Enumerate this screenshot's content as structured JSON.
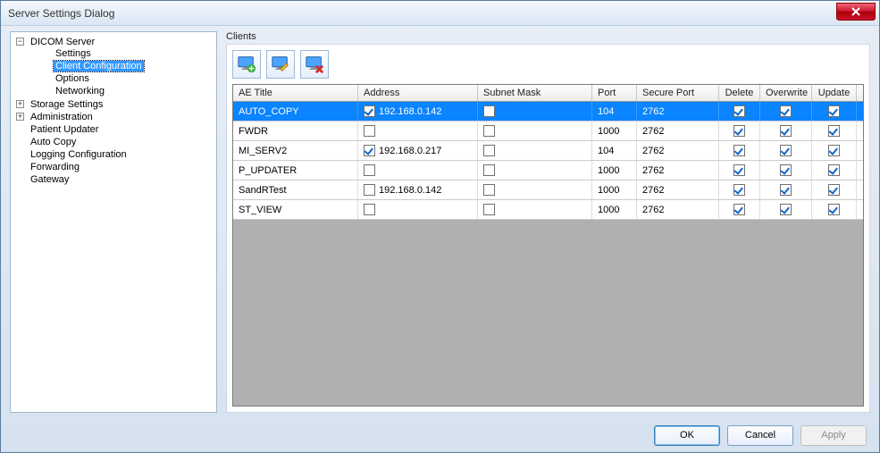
{
  "window": {
    "title": "Server Settings Dialog"
  },
  "tree": {
    "root": {
      "label": "DICOM Server",
      "children": [
        "Settings",
        "Client Configuration",
        "Options",
        "Networking"
      ]
    },
    "others": [
      "Storage Settings",
      "Administration",
      "Patient Updater",
      "Auto Copy",
      "Logging Configuration",
      "Forwarding",
      "Gateway"
    ],
    "selected": "Client Configuration"
  },
  "section_label": "Clients",
  "toolbar": {
    "add_name": "add-client",
    "edit_name": "edit-client",
    "delete_name": "delete-client"
  },
  "columns": {
    "ae": "AE Title",
    "addr": "Address",
    "subnet": "Subnet Mask",
    "port": "Port",
    "sport": "Secure Port",
    "del": "Delete",
    "ov": "Overwrite",
    "upd": "Update"
  },
  "rows": [
    {
      "ae": "AUTO_COPY",
      "addr_chk": true,
      "addr": "192.168.0.142",
      "subnet_chk": false,
      "port": "104",
      "sport": "2762",
      "del": true,
      "ov": true,
      "upd": true,
      "selected": true
    },
    {
      "ae": "FWDR",
      "addr_chk": false,
      "addr": "",
      "subnet_chk": false,
      "port": "1000",
      "sport": "2762",
      "del": true,
      "ov": true,
      "upd": true,
      "selected": false
    },
    {
      "ae": "MI_SERV2",
      "addr_chk": true,
      "addr": "192.168.0.217",
      "subnet_chk": false,
      "port": "104",
      "sport": "2762",
      "del": true,
      "ov": true,
      "upd": true,
      "selected": false
    },
    {
      "ae": "P_UPDATER",
      "addr_chk": false,
      "addr": "",
      "subnet_chk": false,
      "port": "1000",
      "sport": "2762",
      "del": true,
      "ov": true,
      "upd": true,
      "selected": false
    },
    {
      "ae": "SandRTest",
      "addr_chk": false,
      "addr": "192.168.0.142",
      "subnet_chk": false,
      "port": "1000",
      "sport": "2762",
      "del": true,
      "ov": true,
      "upd": true,
      "selected": false
    },
    {
      "ae": "ST_VIEW",
      "addr_chk": false,
      "addr": "",
      "subnet_chk": false,
      "port": "1000",
      "sport": "2762",
      "del": true,
      "ov": true,
      "upd": true,
      "selected": false
    }
  ],
  "buttons": {
    "ok": "OK",
    "cancel": "Cancel",
    "apply": "Apply"
  }
}
